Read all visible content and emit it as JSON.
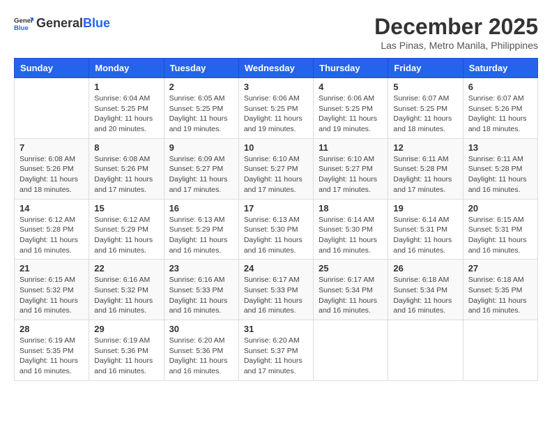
{
  "header": {
    "logo_general": "General",
    "logo_blue": "Blue",
    "month_title": "December 2025",
    "location": "Las Pinas, Metro Manila, Philippines"
  },
  "days_of_week": [
    "Sunday",
    "Monday",
    "Tuesday",
    "Wednesday",
    "Thursday",
    "Friday",
    "Saturday"
  ],
  "weeks": [
    [
      {
        "day": "",
        "info": ""
      },
      {
        "day": "1",
        "info": "Sunrise: 6:04 AM\nSunset: 5:25 PM\nDaylight: 11 hours\nand 20 minutes."
      },
      {
        "day": "2",
        "info": "Sunrise: 6:05 AM\nSunset: 5:25 PM\nDaylight: 11 hours\nand 19 minutes."
      },
      {
        "day": "3",
        "info": "Sunrise: 6:06 AM\nSunset: 5:25 PM\nDaylight: 11 hours\nand 19 minutes."
      },
      {
        "day": "4",
        "info": "Sunrise: 6:06 AM\nSunset: 5:25 PM\nDaylight: 11 hours\nand 19 minutes."
      },
      {
        "day": "5",
        "info": "Sunrise: 6:07 AM\nSunset: 5:25 PM\nDaylight: 11 hours\nand 18 minutes."
      },
      {
        "day": "6",
        "info": "Sunrise: 6:07 AM\nSunset: 5:26 PM\nDaylight: 11 hours\nand 18 minutes."
      }
    ],
    [
      {
        "day": "7",
        "info": "Sunrise: 6:08 AM\nSunset: 5:26 PM\nDaylight: 11 hours\nand 18 minutes."
      },
      {
        "day": "8",
        "info": "Sunrise: 6:08 AM\nSunset: 5:26 PM\nDaylight: 11 hours\nand 17 minutes."
      },
      {
        "day": "9",
        "info": "Sunrise: 6:09 AM\nSunset: 5:27 PM\nDaylight: 11 hours\nand 17 minutes."
      },
      {
        "day": "10",
        "info": "Sunrise: 6:10 AM\nSunset: 5:27 PM\nDaylight: 11 hours\nand 17 minutes."
      },
      {
        "day": "11",
        "info": "Sunrise: 6:10 AM\nSunset: 5:27 PM\nDaylight: 11 hours\nand 17 minutes."
      },
      {
        "day": "12",
        "info": "Sunrise: 6:11 AM\nSunset: 5:28 PM\nDaylight: 11 hours\nand 17 minutes."
      },
      {
        "day": "13",
        "info": "Sunrise: 6:11 AM\nSunset: 5:28 PM\nDaylight: 11 hours\nand 16 minutes."
      }
    ],
    [
      {
        "day": "14",
        "info": "Sunrise: 6:12 AM\nSunset: 5:28 PM\nDaylight: 11 hours\nand 16 minutes."
      },
      {
        "day": "15",
        "info": "Sunrise: 6:12 AM\nSunset: 5:29 PM\nDaylight: 11 hours\nand 16 minutes."
      },
      {
        "day": "16",
        "info": "Sunrise: 6:13 AM\nSunset: 5:29 PM\nDaylight: 11 hours\nand 16 minutes."
      },
      {
        "day": "17",
        "info": "Sunrise: 6:13 AM\nSunset: 5:30 PM\nDaylight: 11 hours\nand 16 minutes."
      },
      {
        "day": "18",
        "info": "Sunrise: 6:14 AM\nSunset: 5:30 PM\nDaylight: 11 hours\nand 16 minutes."
      },
      {
        "day": "19",
        "info": "Sunrise: 6:14 AM\nSunset: 5:31 PM\nDaylight: 11 hours\nand 16 minutes."
      },
      {
        "day": "20",
        "info": "Sunrise: 6:15 AM\nSunset: 5:31 PM\nDaylight: 11 hours\nand 16 minutes."
      }
    ],
    [
      {
        "day": "21",
        "info": "Sunrise: 6:15 AM\nSunset: 5:32 PM\nDaylight: 11 hours\nand 16 minutes."
      },
      {
        "day": "22",
        "info": "Sunrise: 6:16 AM\nSunset: 5:32 PM\nDaylight: 11 hours\nand 16 minutes."
      },
      {
        "day": "23",
        "info": "Sunrise: 6:16 AM\nSunset: 5:33 PM\nDaylight: 11 hours\nand 16 minutes."
      },
      {
        "day": "24",
        "info": "Sunrise: 6:17 AM\nSunset: 5:33 PM\nDaylight: 11 hours\nand 16 minutes."
      },
      {
        "day": "25",
        "info": "Sunrise: 6:17 AM\nSunset: 5:34 PM\nDaylight: 11 hours\nand 16 minutes."
      },
      {
        "day": "26",
        "info": "Sunrise: 6:18 AM\nSunset: 5:34 PM\nDaylight: 11 hours\nand 16 minutes."
      },
      {
        "day": "27",
        "info": "Sunrise: 6:18 AM\nSunset: 5:35 PM\nDaylight: 11 hours\nand 16 minutes."
      }
    ],
    [
      {
        "day": "28",
        "info": "Sunrise: 6:19 AM\nSunset: 5:35 PM\nDaylight: 11 hours\nand 16 minutes."
      },
      {
        "day": "29",
        "info": "Sunrise: 6:19 AM\nSunset: 5:36 PM\nDaylight: 11 hours\nand 16 minutes."
      },
      {
        "day": "30",
        "info": "Sunrise: 6:20 AM\nSunset: 5:36 PM\nDaylight: 11 hours\nand 16 minutes."
      },
      {
        "day": "31",
        "info": "Sunrise: 6:20 AM\nSunset: 5:37 PM\nDaylight: 11 hours\nand 17 minutes."
      },
      {
        "day": "",
        "info": ""
      },
      {
        "day": "",
        "info": ""
      },
      {
        "day": "",
        "info": ""
      }
    ]
  ]
}
